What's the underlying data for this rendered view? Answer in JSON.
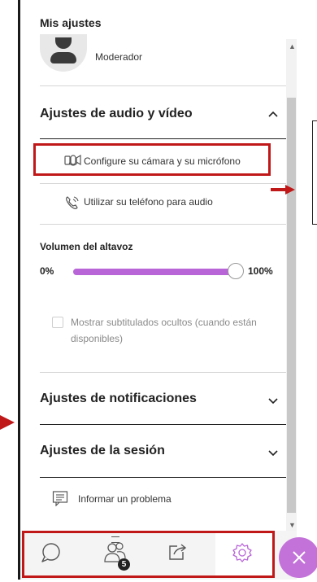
{
  "panel": {
    "title": "Mis ajustes",
    "profile": {
      "role": "Moderador"
    }
  },
  "audio_video": {
    "title": "Ajustes de audio y vídeo",
    "expanded": true,
    "camera_mic_label": "Configure su cámara y su micrófono",
    "phone_label": "Utilizar su teléfono para audio",
    "volume": {
      "label": "Volumen del altavoz",
      "min_label": "0%",
      "max_label": "100%",
      "value_percent": 100
    },
    "captions_label": "Mostrar subtitulados ocultos (cuando están disponibles)",
    "captions_checked": false
  },
  "notifications": {
    "title": "Ajustes de notificaciones",
    "expanded": false
  },
  "session": {
    "title": "Ajustes de la sesión",
    "expanded": false
  },
  "report": {
    "label": "Informar un problema"
  },
  "bottom_bar": {
    "items": [
      {
        "icon": "chat-icon"
      },
      {
        "icon": "participants-icon",
        "badge": "5"
      },
      {
        "icon": "share-icon"
      },
      {
        "icon": "settings-icon",
        "active": true
      }
    ],
    "close_icon": "close-icon"
  },
  "colors": {
    "accent": "#b865d8",
    "highlight": "#c01818",
    "fab": "#c372d9"
  }
}
